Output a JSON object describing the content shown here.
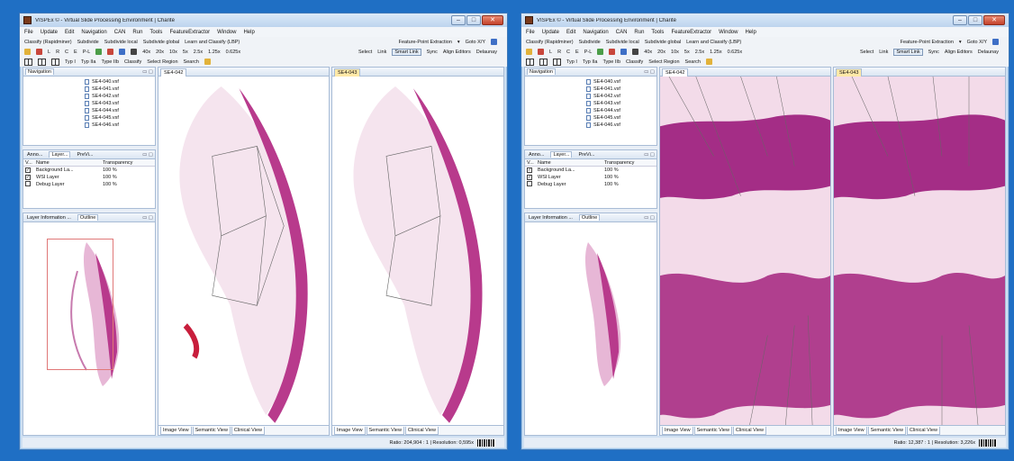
{
  "app": {
    "title": "VISPEx © - Virtual Slide Processing Environment | Charité",
    "window_buttons": {
      "minimize": "–",
      "maximize": "□",
      "close": "✕"
    }
  },
  "menu": [
    "File",
    "Update",
    "Edit",
    "Navigation",
    "CAN",
    "Run",
    "Tools",
    "FeatureExtractor",
    "Window",
    "Help"
  ],
  "classify_toolbar": {
    "items": [
      "Classify (Rapidminer)",
      "Subdivide",
      "Subdivide local",
      "Subdivide global",
      "Learn and Classify (LBP)"
    ],
    "feature_point": "Feature-Point Extraction",
    "goto": "Goto X/Y"
  },
  "tool_toolbar": {
    "letters": [
      "L",
      "R",
      "C",
      "E",
      "P-L"
    ],
    "zoom": [
      "40x",
      "20x",
      "10x",
      "5x",
      "2.5x",
      "1.25x",
      "0.625x"
    ],
    "right": [
      "Select",
      "Link",
      "Smart Link",
      "Sync",
      "Align Editors",
      "Delaunay"
    ]
  },
  "type_toolbar": {
    "items": [
      "Typ I",
      "Typ IIa",
      "Type IIb",
      "Classify",
      "Select Region"
    ],
    "search": "Search"
  },
  "navigation": {
    "tab": "Navigation",
    "files": [
      "SE4-040.vsf",
      "SE4-041.vsf",
      "SE4-042.vsf",
      "SE4-043.vsf",
      "SE4-044.vsf",
      "SE4-045.vsf",
      "SE4-046.vsf"
    ]
  },
  "layers": {
    "tabs": [
      "Anno...",
      "Layer...",
      "PreVi..."
    ],
    "header": {
      "visible": "V...",
      "name": "Name",
      "transparency": "Transparency"
    },
    "rows": [
      {
        "name": "Background La...",
        "transparency": "100 %",
        "checked": true
      },
      {
        "name": "WSI Layer",
        "transparency": "100 %",
        "checked": true
      },
      {
        "name": "Debug Layer",
        "transparency": "100 %",
        "checked": false
      }
    ]
  },
  "info_panel": {
    "tabs": [
      "Layer Information ...",
      "Outline"
    ]
  },
  "editors": [
    {
      "tab": "SE4-042",
      "selected": false
    },
    {
      "tab": "SE4-043",
      "selected": true
    }
  ],
  "view_tabs": [
    "Image View",
    "Semantic View",
    "Clinical View"
  ],
  "status": {
    "w1": {
      "ratio": "Ratio: 204,904 : 1 | Resolution: 0,595x"
    },
    "w2": {
      "ratio": "Ratio: 12,387 : 1 | Resolution: 3,226x"
    }
  },
  "colors": {
    "tissue": "#b83a8c",
    "tissue_light": "#e7b7d6",
    "annotation": "#f3f0b8",
    "accent": "#1f6fc4"
  }
}
